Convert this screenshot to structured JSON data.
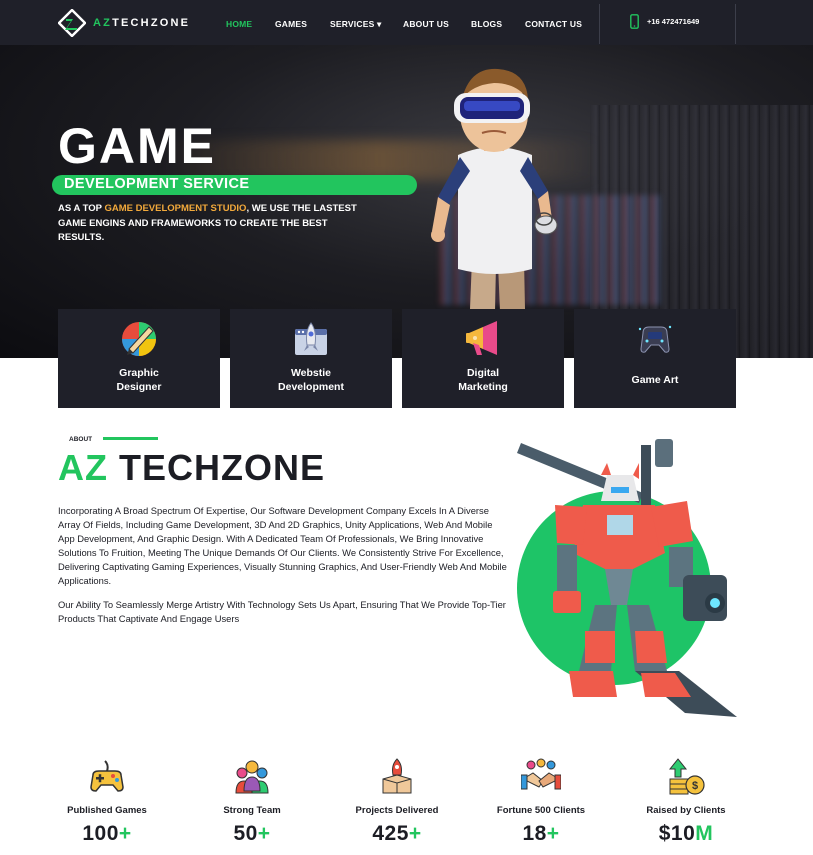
{
  "nav": {
    "logo": {
      "accent": "AZ",
      "text": "TECHZONE"
    },
    "links": [
      {
        "label": "HOME",
        "active": true
      },
      {
        "label": "GAMES",
        "active": false
      },
      {
        "label": "SERVICES ▾",
        "active": false
      },
      {
        "label": "ABOUT US",
        "active": false
      },
      {
        "label": "BLOGS",
        "active": false
      },
      {
        "label": "CONTACT US",
        "active": false
      }
    ],
    "phone": "+16 472471649",
    "phone_icon": "mobile-phone-icon"
  },
  "hero": {
    "title": "GAME",
    "subtitle": "DEVELOPMENT SERVICE",
    "desc_pre": "AS A TOP ",
    "desc_highlight": "GAME DEVELOPMENT STUDIO",
    "desc_post": ", WE USE THE LASTEST GAME ENGINS AND FRAMEWORKS TO CREATE THE BEST RESULTS."
  },
  "services": [
    {
      "line1": "Graphic",
      "line2": "Designer",
      "icon": "color-wheel-pen-icon"
    },
    {
      "line1": "Webstie",
      "line2": "Development",
      "icon": "browser-rocket-icon"
    },
    {
      "line1": "Digital",
      "line2": "Marketing",
      "icon": "megaphone-icon"
    },
    {
      "line1": "Game Art",
      "line2": "",
      "icon": "nft-gamepad-icon"
    }
  ],
  "about": {
    "tag": "ABOUT",
    "title_accent": "AZ",
    "title_rest": "TECHZONE",
    "para1": "Incorporating A Broad Spectrum Of Expertise, Our Software Development Company Excels In A Diverse Array Of Fields, Including Game Development, 3D And 2D Graphics, Unity Applications, Web And Mobile App Development, And Graphic Design. With A Dedicated Team Of Professionals, We Bring Innovative Solutions To Fruition, Meeting The Unique Demands Of Our Clients. We Consistently Strive For Excellence, Delivering Captivating Gaming Experiences, Visually Stunning Graphics, And User-Friendly Web And Mobile Applications.",
    "para2": "Our Ability To Seamlessly Merge Artistry With Technology Sets Us Apart, Ensuring That We Provide Top-Tier Products That Captivate And Engage Users"
  },
  "stats": [
    {
      "label": "Published Games",
      "number": "100",
      "suffix": "+",
      "icon": "gamepad-icon"
    },
    {
      "label": "Strong Team",
      "number": "50",
      "suffix": "+",
      "icon": "team-icon"
    },
    {
      "label": "Projects Delivered",
      "number": "425",
      "suffix": "+",
      "icon": "rocket-box-icon"
    },
    {
      "label": "Fortune 500 Clients",
      "number": "18",
      "suffix": "+",
      "icon": "handshake-icon"
    },
    {
      "label": "Raised by Clients",
      "number": "$10",
      "suffix": "M",
      "icon": "money-growth-icon"
    }
  ],
  "colors": {
    "accent": "#22c55e",
    "dark": "#1f2029",
    "highlight": "#f2a93b"
  }
}
